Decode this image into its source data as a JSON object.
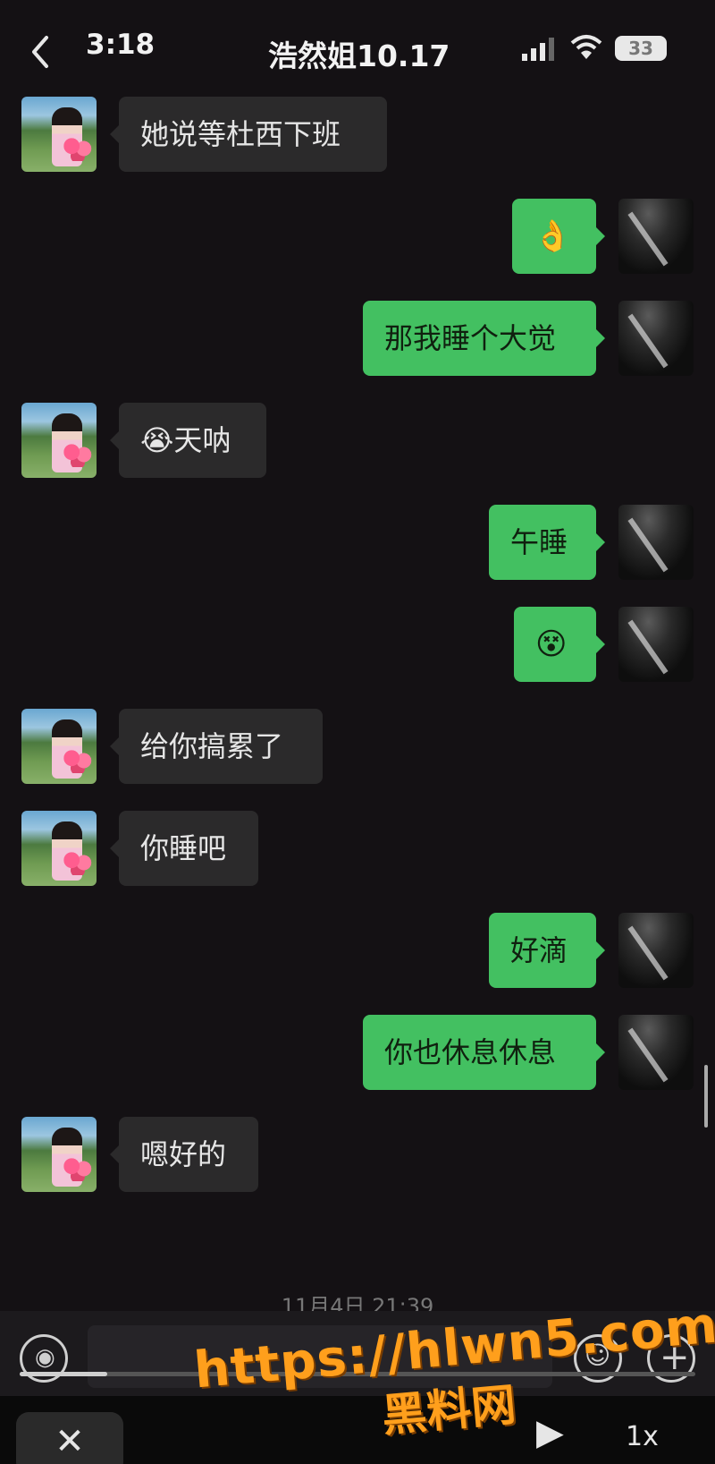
{
  "status": {
    "time": "3:18",
    "battery": "33"
  },
  "header": {
    "title": "浩然姐10.17"
  },
  "messages": [
    {
      "side": "in",
      "text": "她说等杜西下班"
    },
    {
      "side": "out",
      "text": "👌"
    },
    {
      "side": "out",
      "text": "那我睡个大觉"
    },
    {
      "side": "in",
      "text": "😭天呐"
    },
    {
      "side": "out",
      "text": "午睡"
    },
    {
      "side": "out",
      "text": "😵"
    },
    {
      "side": "in",
      "text": "给你搞累了"
    },
    {
      "side": "in",
      "text": "你睡吧"
    },
    {
      "side": "out",
      "text": "好滴"
    },
    {
      "side": "out",
      "text": "你也休息休息"
    },
    {
      "side": "in",
      "text": "嗯好的"
    }
  ],
  "timestamp": "11月4日 21:39",
  "player": {
    "progress_fraction": 0.13,
    "speed": "1x"
  },
  "watermark": {
    "url": "https://hlwn5.com",
    "brand": "黑料网"
  },
  "colors": {
    "background": "#141114",
    "incoming_bubble": "#2b2a2b",
    "outgoing_bubble": "#43c061",
    "watermark": "#ff9f1c"
  }
}
